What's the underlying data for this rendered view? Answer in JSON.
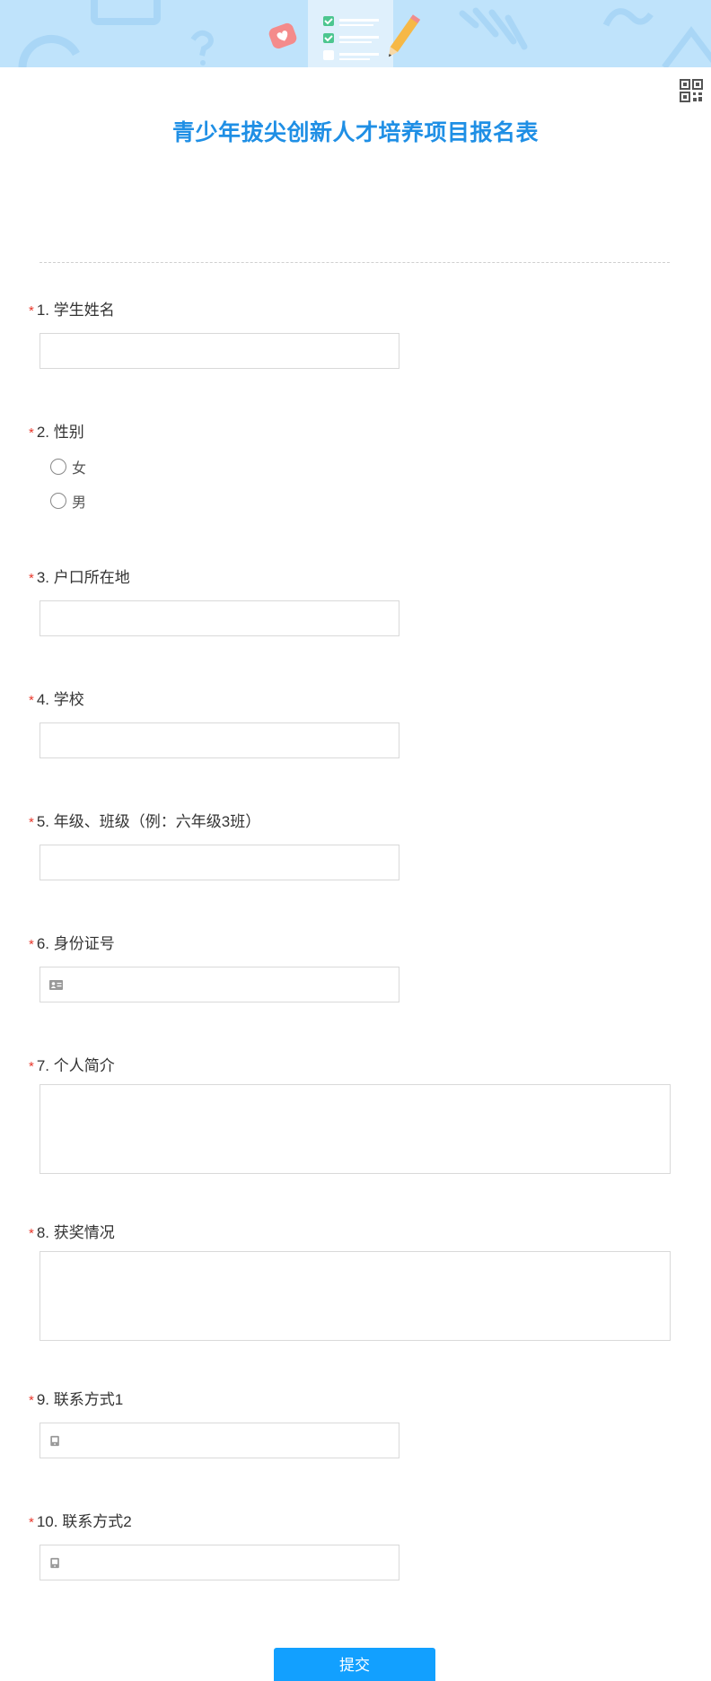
{
  "form": {
    "title": "青少年拔尖创新人才培养项目报名表",
    "required_mark": "*",
    "questions": [
      {
        "label": "1. 学生姓名",
        "type": "text"
      },
      {
        "label": "2. 性别",
        "type": "radio",
        "options": [
          "女",
          "男"
        ]
      },
      {
        "label": "3. 户口所在地",
        "type": "text"
      },
      {
        "label": "4. 学校",
        "type": "text"
      },
      {
        "label": "5. 年级、班级（例：六年级3班）",
        "type": "text"
      },
      {
        "label": "6. 身份证号",
        "type": "text",
        "icon": "id-card-icon"
      },
      {
        "label": "7. 个人简介",
        "type": "textarea"
      },
      {
        "label": "8. 获奖情况",
        "type": "textarea"
      },
      {
        "label": "9. 联系方式1",
        "type": "text",
        "icon": "phone-icon"
      },
      {
        "label": "10. 联系方式2",
        "type": "text",
        "icon": "phone-icon"
      }
    ],
    "submit_label": "提交"
  },
  "header": {
    "qr_icon": "qr-code-icon"
  },
  "colors": {
    "accent": "#1f8fe5",
    "button": "#12a0ff",
    "required": "#e8382c",
    "banner": "#bfe3fb"
  }
}
